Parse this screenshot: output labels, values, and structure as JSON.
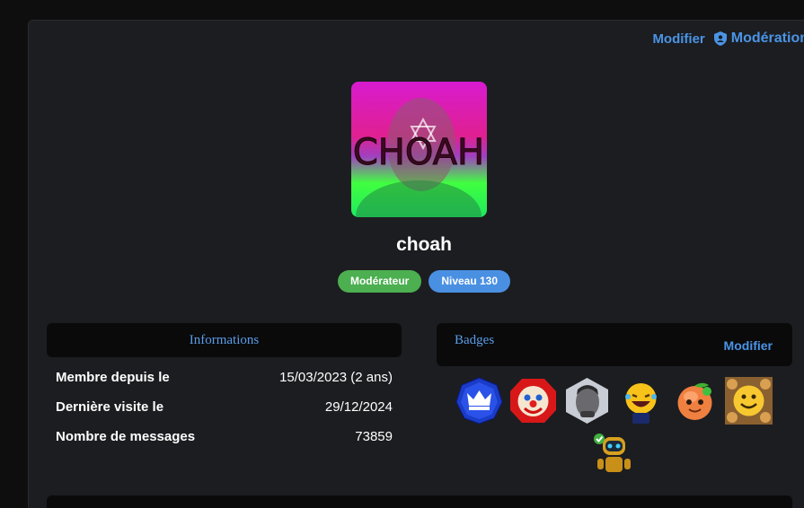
{
  "header": {
    "edit_label": "Modifier",
    "moderation_label": "Modération",
    "moderation_icon": "shield-icon"
  },
  "profile": {
    "username": "choah",
    "avatar_text": "CHOAH",
    "role_badge": "Modérateur",
    "level_badge": "Niveau 130"
  },
  "info": {
    "title": "Informations",
    "rows": [
      {
        "label": "Membre depuis le",
        "value": "15/03/2023 (2 ans)"
      },
      {
        "label": "Dernière visite le",
        "value": "29/12/2024"
      },
      {
        "label": "Nombre de messages",
        "value": "73859"
      }
    ]
  },
  "badges": {
    "title": "Badges",
    "edit_label": "Modifier",
    "items": [
      "crown-badge-icon",
      "clown-badge-icon",
      "chad-face-badge-icon",
      "laughing-emoji-badge-icon",
      "peach-badge-icon",
      "smiley-crowd-badge-icon",
      "robot-badge-icon"
    ]
  },
  "colors": {
    "accent": "#4a94e6",
    "moderator": "#4caf50",
    "level": "#4a90e2"
  }
}
